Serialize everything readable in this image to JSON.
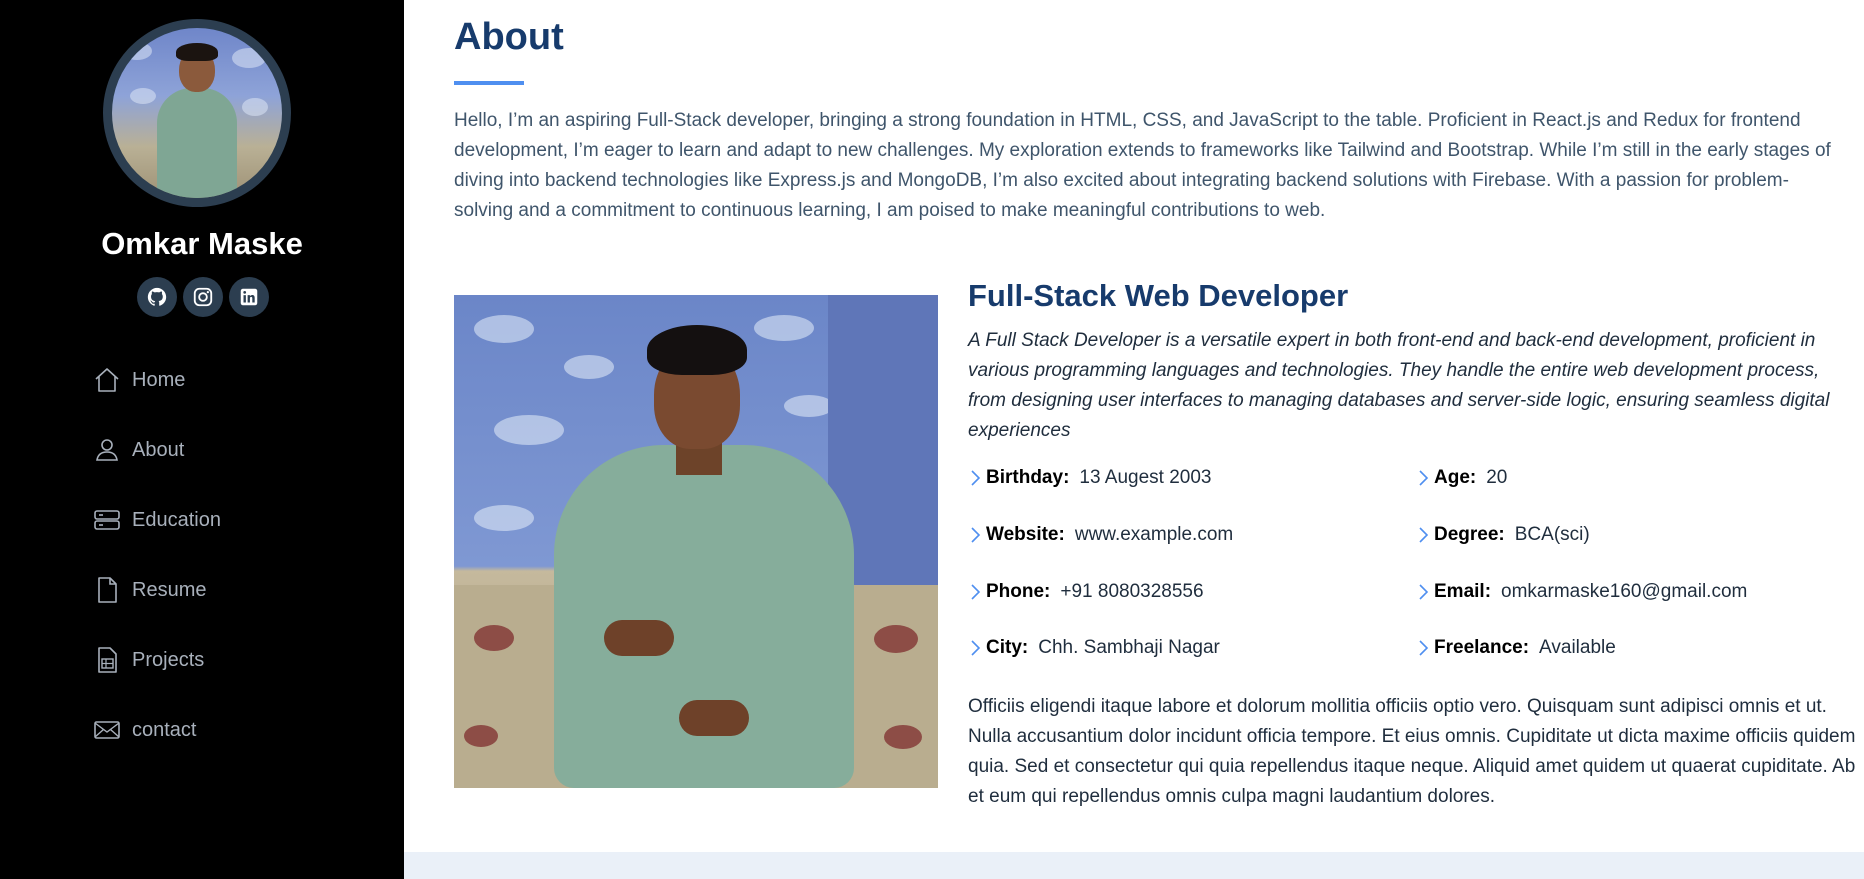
{
  "profile": {
    "name": "Omkar Maske"
  },
  "socials": [
    {
      "icon": "github-icon"
    },
    {
      "icon": "instagram-icon"
    },
    {
      "icon": "linkedin-icon"
    }
  ],
  "nav": {
    "items": [
      {
        "label": "Home",
        "icon": "home-icon"
      },
      {
        "label": "About",
        "icon": "person-icon"
      },
      {
        "label": "Education",
        "icon": "server-icon"
      },
      {
        "label": "Resume",
        "icon": "file-icon"
      },
      {
        "label": "Projects",
        "icon": "document-icon"
      },
      {
        "label": "contact",
        "icon": "envelope-icon"
      }
    ]
  },
  "about": {
    "title": "About",
    "intro": "Hello, I’m an aspiring Full-Stack developer, bringing a strong foundation in HTML, CSS, and JavaScript to the table. Proficient in React.js and Redux for frontend development, I’m eager to learn and adapt to new challenges. My exploration extends to frameworks like Tailwind and Bootstrap. While I’m still in the early stages of diving into backend technologies like Express.js and MongoDB, I’m also excited about integrating backend solutions with Firebase. With a passion for problem-solving and a commitment to continuous learning, I am poised to make meaningful contributions to web.",
    "role": "Full-Stack Web Developer",
    "role_desc": "A Full Stack Developer is a versatile expert in both front-end and back-end development, proficient in various programming languages and technologies. They handle the entire web development process, from designing user interfaces to managing databases and server-side logic, ensuring seamless digital experiences",
    "facts": {
      "birthday": {
        "label": "Birthday:",
        "value": "13 Augest 2003"
      },
      "age": {
        "label": "Age:",
        "value": "20"
      },
      "website": {
        "label": "Website:",
        "value": "www.example.com"
      },
      "degree": {
        "label": "Degree:",
        "value": "BCA(sci)"
      },
      "phone": {
        "label": "Phone:",
        "value": "+91 8080328556"
      },
      "email": {
        "label": "Email:",
        "value": "omkarmaske160@gmail.com"
      },
      "city": {
        "label": "City:",
        "value": "Chh. Sambhaji Nagar"
      },
      "freelance": {
        "label": "Freelance:",
        "value": "Available"
      }
    },
    "outro": "Officiis eligendi itaque labore et dolorum mollitia officiis optio vero. Quisquam sunt adipisci omnis et ut. Nulla accusantium dolor incidunt officia tempore. Et eius omnis. Cupiditate ut dicta maxime officiis quidem quia. Sed et consectetur qui quia repellendus itaque neque. Aliquid amet quidem ut quaerat cupiditate. Ab et eum qui repellendus omnis culpa magni laudantium dolores."
  },
  "colors": {
    "sidebar_bg": "#000000",
    "accent": "#4f8ff0",
    "heading": "#173b6c",
    "nav_text": "#a8b0bb"
  }
}
